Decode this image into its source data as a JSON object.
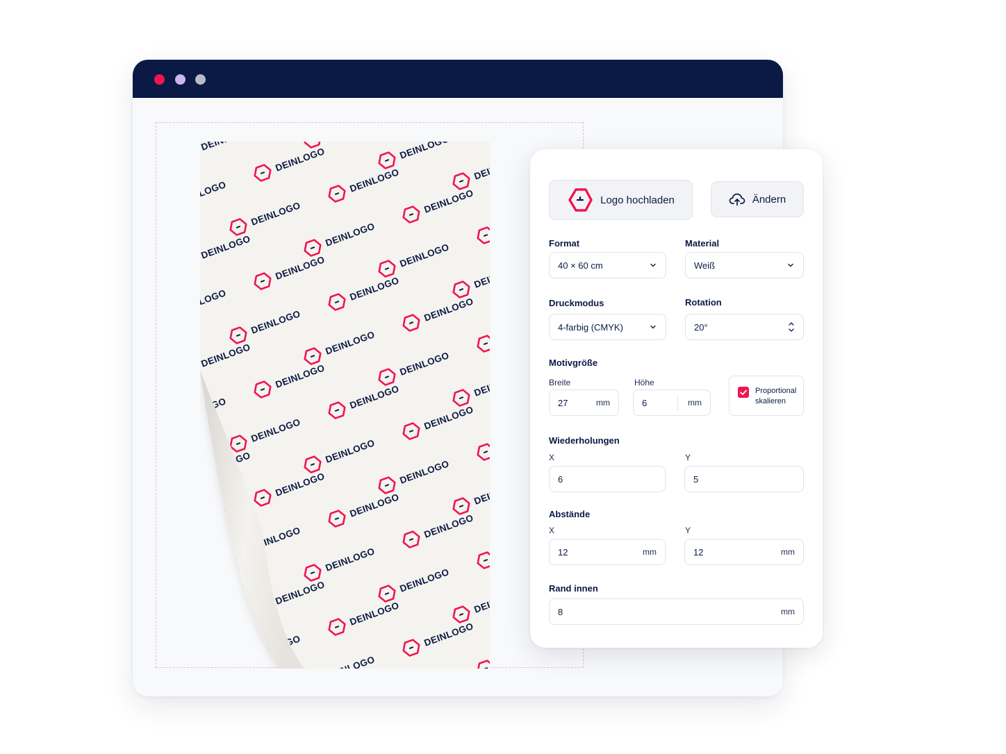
{
  "window": {
    "controls": [
      {
        "name": "close",
        "color": "#f01452"
      },
      {
        "name": "minimize",
        "color": "#c9b6f2"
      },
      {
        "name": "maximize",
        "color": "#b9bcc4"
      }
    ]
  },
  "preview": {
    "logo_text": "DEINLOGO",
    "accent_color": "#f01452",
    "text_color": "#0b1a44"
  },
  "panel": {
    "upload_button": "Logo hochladen",
    "change_button": "Ändern",
    "format": {
      "label": "Format",
      "value": "40 × 60 cm"
    },
    "material": {
      "label": "Material",
      "value": "Weiß"
    },
    "druckmodus": {
      "label": "Druckmodus",
      "value": "4-farbig (CMYK)"
    },
    "rotation": {
      "label": "Rotation",
      "value": "20°"
    },
    "motivgroesse": {
      "label": "Motivgröße",
      "breite_label": "Breite",
      "breite_value": "27",
      "breite_unit": "mm",
      "hoehe_label": "Höhe",
      "hoehe_value": "6",
      "hoehe_unit": "mm",
      "proportional_label_1": "Proportional",
      "proportional_label_2": "skalieren",
      "proportional_checked": true
    },
    "wiederholungen": {
      "label": "Wiederholungen",
      "x_label": "X",
      "x_value": "6",
      "y_label": "Y",
      "y_value": "5"
    },
    "abstaende": {
      "label": "Abstände",
      "x_label": "X",
      "x_value": "12",
      "x_unit": "mm",
      "y_label": "Y",
      "y_value": "12",
      "y_unit": "mm"
    },
    "rand_innen": {
      "label": "Rand innen",
      "value": "8",
      "unit": "mm"
    }
  }
}
